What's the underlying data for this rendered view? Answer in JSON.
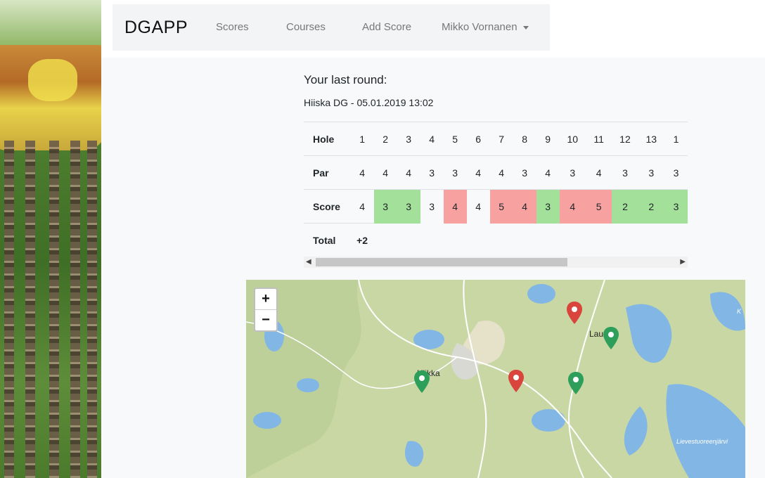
{
  "navbar": {
    "brand": "DGAPP",
    "links": [
      "Scores",
      "Courses",
      "Add Score"
    ],
    "user": "Mikko Vornanen"
  },
  "round": {
    "heading": "Your last round:",
    "course_date": "Hiiska DG - 05.01.2019 13:02"
  },
  "scorecard": {
    "labels": {
      "hole": "Hole",
      "par": "Par",
      "score": "Score",
      "total": "Total"
    },
    "holes": [
      "1",
      "2",
      "3",
      "4",
      "5",
      "6",
      "7",
      "8",
      "9",
      "10",
      "11",
      "12",
      "13",
      "1"
    ],
    "par": [
      "4",
      "4",
      "4",
      "3",
      "3",
      "4",
      "4",
      "3",
      "4",
      "3",
      "4",
      "3",
      "3",
      "3"
    ],
    "score": [
      "4",
      "3",
      "3",
      "3",
      "4",
      "4",
      "5",
      "4",
      "3",
      "4",
      "5",
      "2",
      "2",
      "3"
    ],
    "score_status": [
      "",
      "good",
      "good",
      "",
      "bad",
      "",
      "bad",
      "bad",
      "good",
      "bad",
      "bad",
      "good",
      "good",
      "good"
    ],
    "total": "+2"
  },
  "map": {
    "zoom_in": "+",
    "zoom_out": "−",
    "places": {
      "left": "Hiikka",
      "right": "Laurea",
      "lake": "Lievestuoreenjärvi",
      "edge": "K"
    },
    "markers": [
      {
        "color": "#2e9e5b"
      },
      {
        "color": "#d9443d"
      },
      {
        "color": "#2e9e5b"
      },
      {
        "color": "#d9443d"
      },
      {
        "color": "#2e9e5b"
      }
    ]
  },
  "colors": {
    "good": "#a3e09a",
    "bad": "#f8a1a1"
  }
}
